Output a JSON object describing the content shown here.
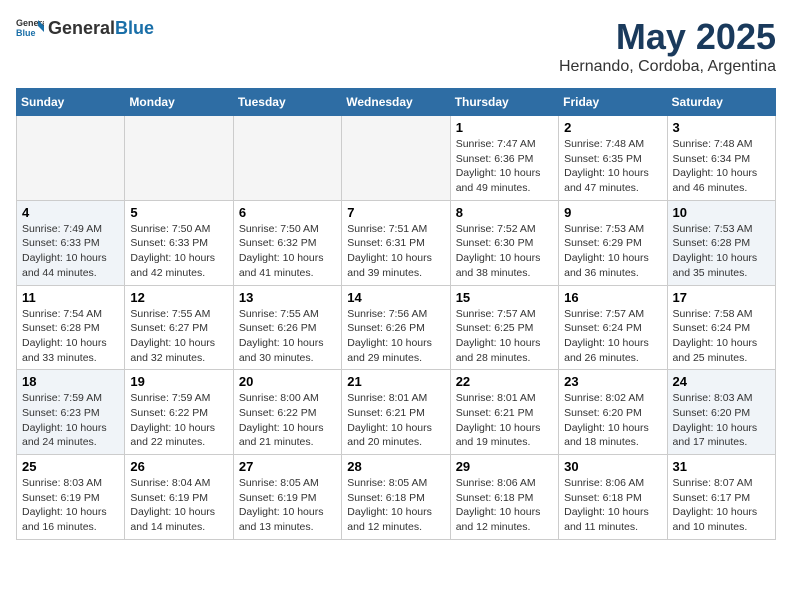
{
  "header": {
    "logo_general": "General",
    "logo_blue": "Blue",
    "title": "May 2025",
    "subtitle": "Hernando, Cordoba, Argentina"
  },
  "weekdays": [
    "Sunday",
    "Monday",
    "Tuesday",
    "Wednesday",
    "Thursday",
    "Friday",
    "Saturday"
  ],
  "weeks": [
    [
      {
        "day": "",
        "info": "",
        "empty": true
      },
      {
        "day": "",
        "info": "",
        "empty": true
      },
      {
        "day": "",
        "info": "",
        "empty": true
      },
      {
        "day": "",
        "info": "",
        "empty": true
      },
      {
        "day": "1",
        "info": "Sunrise: 7:47 AM\nSunset: 6:36 PM\nDaylight: 10 hours\nand 49 minutes."
      },
      {
        "day": "2",
        "info": "Sunrise: 7:48 AM\nSunset: 6:35 PM\nDaylight: 10 hours\nand 47 minutes."
      },
      {
        "day": "3",
        "info": "Sunrise: 7:48 AM\nSunset: 6:34 PM\nDaylight: 10 hours\nand 46 minutes."
      }
    ],
    [
      {
        "day": "4",
        "info": "Sunrise: 7:49 AM\nSunset: 6:33 PM\nDaylight: 10 hours\nand 44 minutes."
      },
      {
        "day": "5",
        "info": "Sunrise: 7:50 AM\nSunset: 6:33 PM\nDaylight: 10 hours\nand 42 minutes."
      },
      {
        "day": "6",
        "info": "Sunrise: 7:50 AM\nSunset: 6:32 PM\nDaylight: 10 hours\nand 41 minutes."
      },
      {
        "day": "7",
        "info": "Sunrise: 7:51 AM\nSunset: 6:31 PM\nDaylight: 10 hours\nand 39 minutes."
      },
      {
        "day": "8",
        "info": "Sunrise: 7:52 AM\nSunset: 6:30 PM\nDaylight: 10 hours\nand 38 minutes."
      },
      {
        "day": "9",
        "info": "Sunrise: 7:53 AM\nSunset: 6:29 PM\nDaylight: 10 hours\nand 36 minutes."
      },
      {
        "day": "10",
        "info": "Sunrise: 7:53 AM\nSunset: 6:28 PM\nDaylight: 10 hours\nand 35 minutes."
      }
    ],
    [
      {
        "day": "11",
        "info": "Sunrise: 7:54 AM\nSunset: 6:28 PM\nDaylight: 10 hours\nand 33 minutes."
      },
      {
        "day": "12",
        "info": "Sunrise: 7:55 AM\nSunset: 6:27 PM\nDaylight: 10 hours\nand 32 minutes."
      },
      {
        "day": "13",
        "info": "Sunrise: 7:55 AM\nSunset: 6:26 PM\nDaylight: 10 hours\nand 30 minutes."
      },
      {
        "day": "14",
        "info": "Sunrise: 7:56 AM\nSunset: 6:26 PM\nDaylight: 10 hours\nand 29 minutes."
      },
      {
        "day": "15",
        "info": "Sunrise: 7:57 AM\nSunset: 6:25 PM\nDaylight: 10 hours\nand 28 minutes."
      },
      {
        "day": "16",
        "info": "Sunrise: 7:57 AM\nSunset: 6:24 PM\nDaylight: 10 hours\nand 26 minutes."
      },
      {
        "day": "17",
        "info": "Sunrise: 7:58 AM\nSunset: 6:24 PM\nDaylight: 10 hours\nand 25 minutes."
      }
    ],
    [
      {
        "day": "18",
        "info": "Sunrise: 7:59 AM\nSunset: 6:23 PM\nDaylight: 10 hours\nand 24 minutes."
      },
      {
        "day": "19",
        "info": "Sunrise: 7:59 AM\nSunset: 6:22 PM\nDaylight: 10 hours\nand 22 minutes."
      },
      {
        "day": "20",
        "info": "Sunrise: 8:00 AM\nSunset: 6:22 PM\nDaylight: 10 hours\nand 21 minutes."
      },
      {
        "day": "21",
        "info": "Sunrise: 8:01 AM\nSunset: 6:21 PM\nDaylight: 10 hours\nand 20 minutes."
      },
      {
        "day": "22",
        "info": "Sunrise: 8:01 AM\nSunset: 6:21 PM\nDaylight: 10 hours\nand 19 minutes."
      },
      {
        "day": "23",
        "info": "Sunrise: 8:02 AM\nSunset: 6:20 PM\nDaylight: 10 hours\nand 18 minutes."
      },
      {
        "day": "24",
        "info": "Sunrise: 8:03 AM\nSunset: 6:20 PM\nDaylight: 10 hours\nand 17 minutes."
      }
    ],
    [
      {
        "day": "25",
        "info": "Sunrise: 8:03 AM\nSunset: 6:19 PM\nDaylight: 10 hours\nand 16 minutes."
      },
      {
        "day": "26",
        "info": "Sunrise: 8:04 AM\nSunset: 6:19 PM\nDaylight: 10 hours\nand 14 minutes."
      },
      {
        "day": "27",
        "info": "Sunrise: 8:05 AM\nSunset: 6:19 PM\nDaylight: 10 hours\nand 13 minutes."
      },
      {
        "day": "28",
        "info": "Sunrise: 8:05 AM\nSunset: 6:18 PM\nDaylight: 10 hours\nand 12 minutes."
      },
      {
        "day": "29",
        "info": "Sunrise: 8:06 AM\nSunset: 6:18 PM\nDaylight: 10 hours\nand 12 minutes."
      },
      {
        "day": "30",
        "info": "Sunrise: 8:06 AM\nSunset: 6:18 PM\nDaylight: 10 hours\nand 11 minutes."
      },
      {
        "day": "31",
        "info": "Sunrise: 8:07 AM\nSunset: 6:17 PM\nDaylight: 10 hours\nand 10 minutes."
      }
    ]
  ]
}
